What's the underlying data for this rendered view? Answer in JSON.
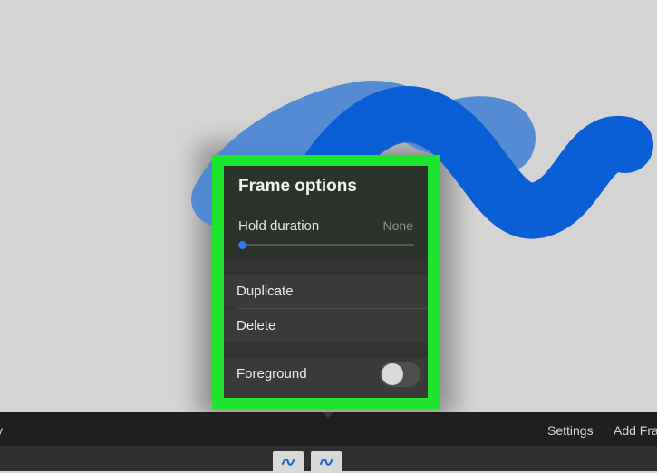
{
  "popover": {
    "title": "Frame options",
    "hold_duration_label": "Hold duration",
    "hold_duration_value": "None",
    "hold_duration_slider_fraction": 0,
    "duplicate_label": "Duplicate",
    "delete_label": "Delete",
    "foreground_label": "Foreground",
    "foreground_enabled": false
  },
  "toolbar": {
    "left_label_partial": "y",
    "settings_label": "Settings",
    "add_frame_label": "Add Fra"
  },
  "colors": {
    "highlight_border": "#1ee62e",
    "stroke_blue": "#0a5fd6",
    "stroke_light_blue": "#4e87d4",
    "slider_accent": "#2f7bf2"
  }
}
